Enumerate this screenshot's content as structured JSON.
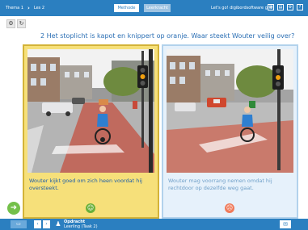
{
  "breadcrumb": {
    "theme": "Thema 1",
    "lesson": "Les 2"
  },
  "tabs": [
    {
      "label": "Methode"
    },
    {
      "label": "Leerkracht"
    }
  ],
  "brand": "Let's go! digibordsoftware gr 7",
  "question": "2 Het stoplicht is kapot en knippert op oranje. Waar steekt Wouter veilig over?",
  "answers": [
    {
      "caption": "Wouter kijkt goed om zich heen voordat hij oversteekt.",
      "status": "correct"
    },
    {
      "caption": "Wouter mag voorrang nemen omdat hij rechtdoor op dezelfde weg gaat.",
      "status": "incorrect"
    }
  ],
  "footer": {
    "title": "Opdracht",
    "subtitle": "Leerling (Taak 2)"
  },
  "colors": {
    "primary": "#2b7fc0",
    "highlight": "#f6e07a",
    "correct": "#68b03a",
    "incorrect": "#f07a5a"
  }
}
